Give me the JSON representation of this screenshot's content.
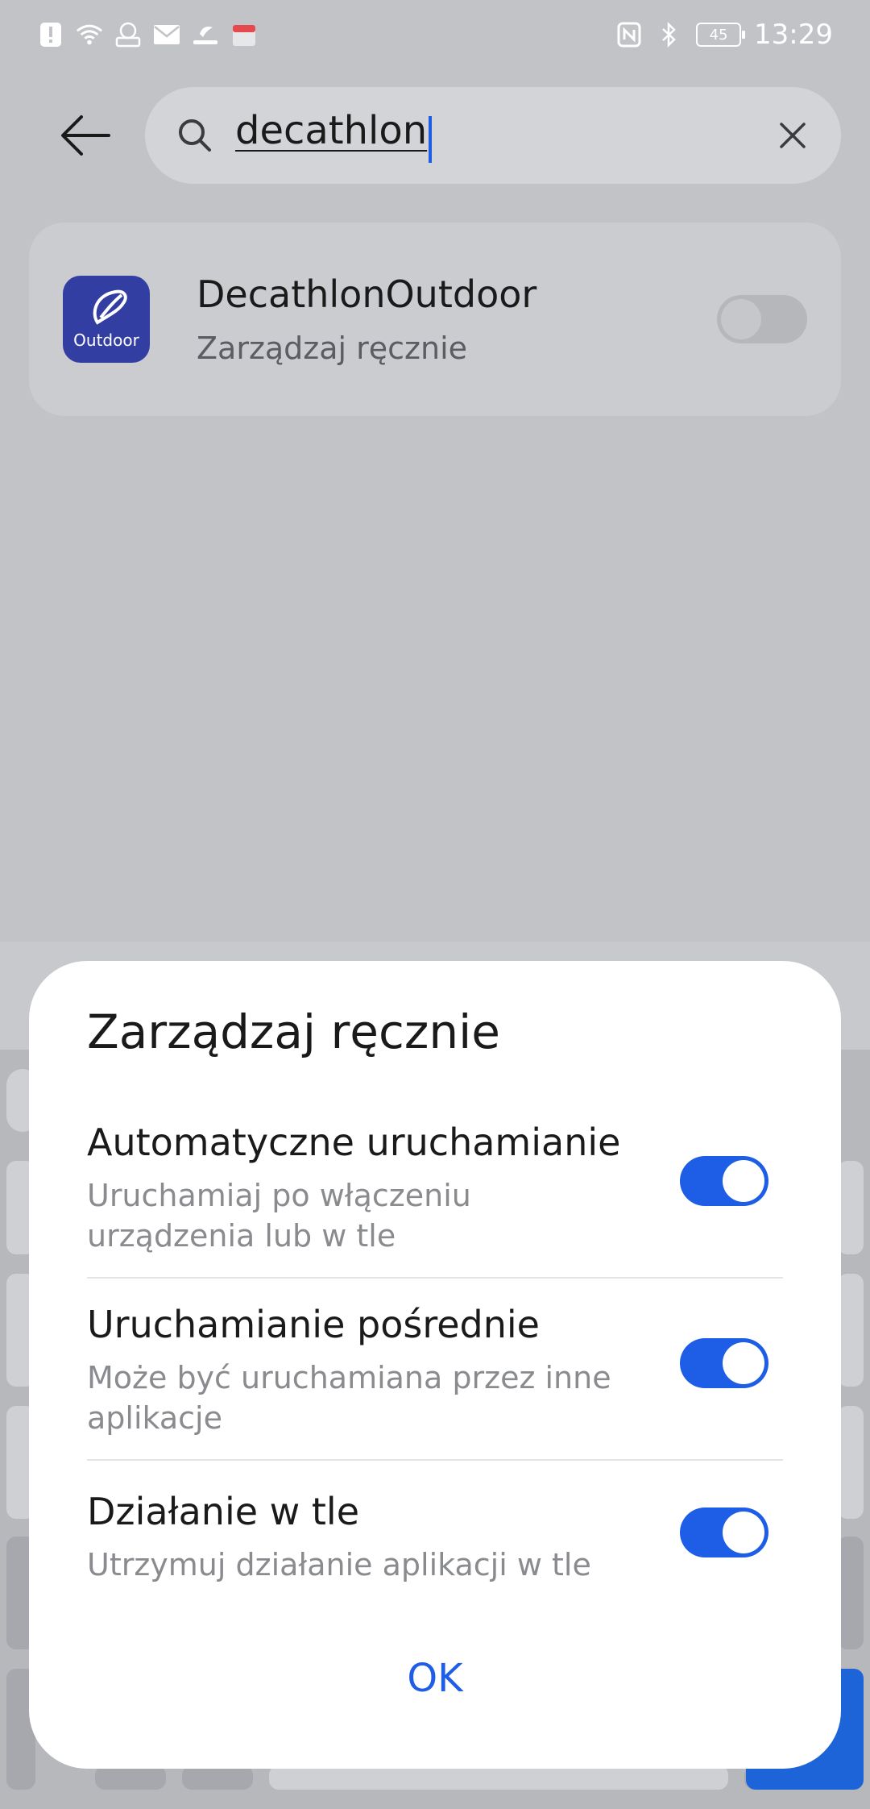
{
  "status_bar": {
    "time": "13:29",
    "battery": "45",
    "notification_icons": [
      "alert-icon",
      "wifi-icon",
      "app-notification-icon",
      "mail-icon",
      "outdoor-app-icon",
      "calendar-app-icon"
    ],
    "right_icons": [
      "nfc-icon",
      "bluetooth-icon",
      "battery-icon"
    ]
  },
  "search": {
    "query": "decathlon"
  },
  "result": {
    "app_name": "DecathlonOutdoor",
    "subtitle": "Zarządzaj ręcznie",
    "icon_label": "Outdoor",
    "icon_color": "#333ea3",
    "toggle_state": "off"
  },
  "dialog": {
    "title": "Zarządzaj ręcznie",
    "options": [
      {
        "title": "Automatyczne uruchamianie",
        "description": "Uruchamiaj po włączeniu urządzenia lub w tle",
        "enabled": true
      },
      {
        "title": "Uruchamianie pośrednie",
        "description": "Może być uruchamiana przez inne aplikacje",
        "enabled": true
      },
      {
        "title": "Działanie w tle",
        "description": "Utrzymuj działanie aplikacji w tle",
        "enabled": true
      }
    ],
    "ok_label": "OK",
    "accent_color": "#1e5ee6"
  }
}
